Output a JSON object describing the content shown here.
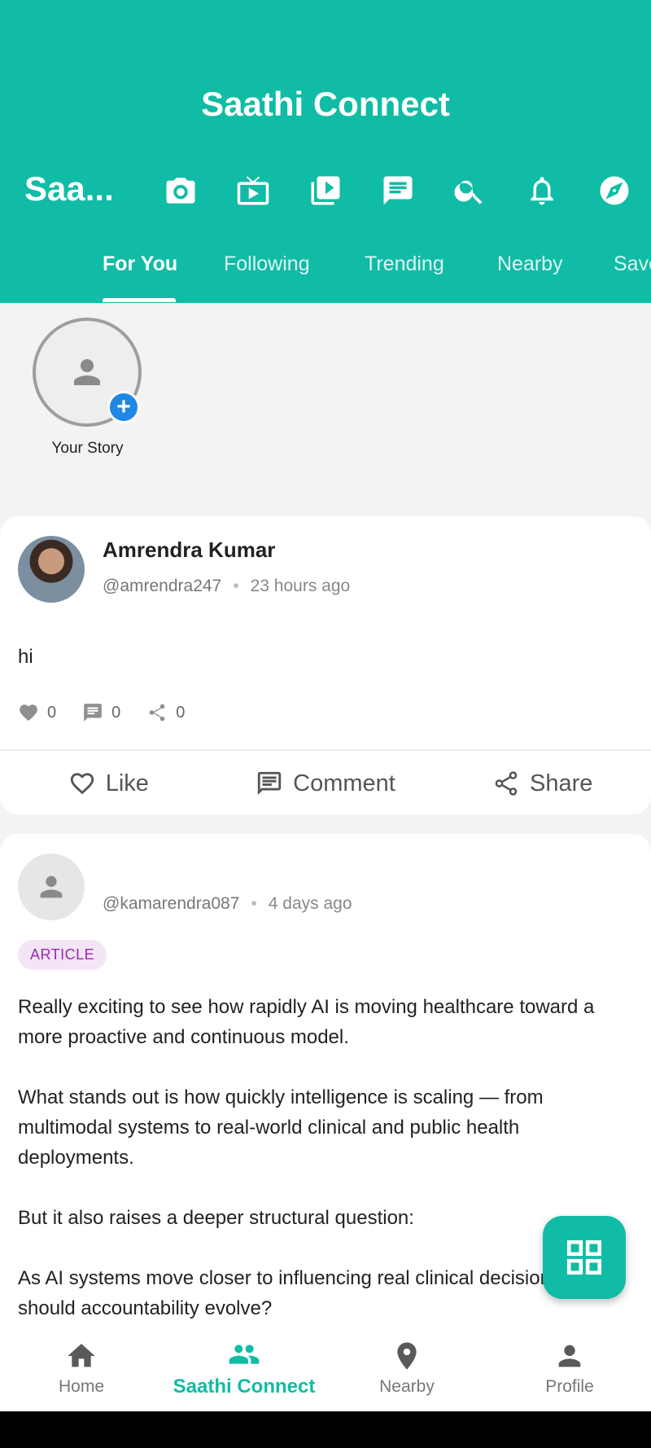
{
  "app": {
    "title": "Saathi Connect",
    "brand_short": "Saa..."
  },
  "header_icons": [
    "camera-icon",
    "tv-icon",
    "video-library-icon",
    "chat-icon",
    "search-icon",
    "bell-icon",
    "compass-icon"
  ],
  "tabs": [
    {
      "label": "For You",
      "active": true
    },
    {
      "label": "Following"
    },
    {
      "label": "Trending"
    },
    {
      "label": "Nearby"
    },
    {
      "label": "Save"
    }
  ],
  "story": {
    "label": "Your Story"
  },
  "posts": [
    {
      "author": "Amrendra Kumar",
      "handle": "@amrendra247",
      "time": "23 hours ago",
      "text": "hi",
      "likes": "0",
      "comments": "0",
      "shares": "0"
    },
    {
      "author": "",
      "handle": "@kamarendra087",
      "time": "4 days ago",
      "badge": "ARTICLE",
      "paragraphs": [
        "Really exciting to see how rapidly AI is moving healthcare toward a more proactive and continuous model.",
        "What stands out is how quickly intelligence is scaling — from multimodal systems to real-world clinical and public health deployments.",
        "But it also raises a deeper structural question:",
        "As AI systems move closer to influencing real clinical decisions, how should accountability evolve?"
      ]
    }
  ],
  "actions": {
    "like": "Like",
    "comment": "Comment",
    "share": "Share"
  },
  "nav": [
    {
      "label": "Home"
    },
    {
      "label": "Saathi Connect",
      "active": true
    },
    {
      "label": "Nearby"
    },
    {
      "label": "Profile"
    }
  ],
  "colors": {
    "primary": "#10bca5",
    "badge_text": "#9c27b0",
    "story_plus": "#1e88e5"
  }
}
